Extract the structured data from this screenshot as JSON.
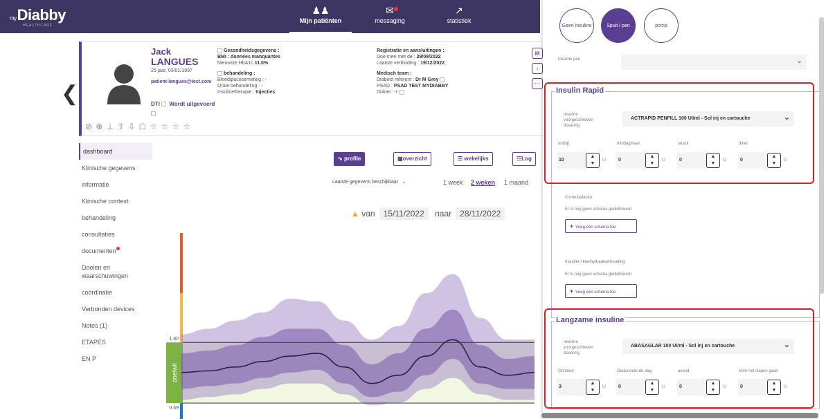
{
  "brand": {
    "prefix": "my",
    "name": "Diabby",
    "sub": "HEALTHCARE"
  },
  "nav": [
    {
      "label": "Mijn patiënten",
      "icon": "users-icon",
      "active": true
    },
    {
      "label": "messaging",
      "icon": "chat-icon",
      "active": false,
      "badge": true
    },
    {
      "label": "statistiek",
      "icon": "chart-icon",
      "active": false
    }
  ],
  "patient": {
    "first": "Jack",
    "last": "LANGUES",
    "age": "25 jaar, 03/01/1997",
    "email": "patient-langues@test.com",
    "dti": "DTI",
    "dti_status": "Wordt uitgevoerd",
    "icons": "⊘ ⊕ ⊥ ⇧ ⇩ ☖ ☆ ☆ ☆ ☆"
  },
  "health": {
    "title": "Gezondheidsgegevens :",
    "bmi": "BMI : données manquantes",
    "hba1c_label": "Nieuwste HbA1c",
    "hba1c": "11.0%",
    "treat_title": "behandeling :",
    "glucose": "Bloedglucosemeting : -",
    "oral": "Orale behandeling : -",
    "insulin_label": "Insulinetherapie :",
    "insulin": "Injecties"
  },
  "registration": {
    "title": "Registratie en aansluitingen :",
    "since_label": "Doe mee met de :",
    "since": "29/09/2022",
    "last_label": "Laatste verbinding :",
    "last": "19/12/2022",
    "team_title": "Medisch team :",
    "ref_label": "Diabeto referent :",
    "ref": "Dr M Grey",
    "psad_label": "PSAD :",
    "psad": "PSAD TEST MYDIABBY",
    "doctor": "Dokter : +"
  },
  "sidebar": [
    {
      "label": "dashboard",
      "active": true
    },
    {
      "label": "Klinische gegevens"
    },
    {
      "label": "informatie"
    },
    {
      "label": "Klinische context"
    },
    {
      "label": "behandeling"
    },
    {
      "label": "consultaties"
    },
    {
      "label": "documenten",
      "badge": true
    },
    {
      "label": "Doelen en waarschuwingen"
    },
    {
      "label": "coördinatie"
    },
    {
      "label": "Verbonden devices"
    },
    {
      "label": "Notes (1)"
    },
    {
      "label": "ETAPES"
    },
    {
      "label": "EN P"
    }
  ],
  "toolbar": {
    "profile": "profile",
    "overview": "overzicht",
    "weekly": "wekelijks",
    "log": "Log"
  },
  "period": {
    "select": "Laatste gegevens beschikbaar",
    "w1": "1 week",
    "w2": "2 weken",
    "m1": "1 maand"
  },
  "dates": {
    "from_label": "van",
    "from": "15/11/2022",
    "to_label": "naar",
    "to": "28/11/2022"
  },
  "chart_data": {
    "type": "area",
    "target_label": "doelwit",
    "y_ticks": [
      "1.80",
      "0.69"
    ],
    "target_range": [
      0.69,
      1.8
    ],
    "ylim": [
      0.4,
      3.8
    ],
    "x": [
      0,
      1,
      2,
      3,
      4,
      5,
      6,
      7,
      8,
      9,
      10,
      11,
      12,
      13
    ],
    "series": [
      {
        "role": "median",
        "values": [
          1.25,
          1.28,
          1.35,
          1.45,
          1.55,
          1.6,
          1.35,
          1.05,
          1.2,
          1.55,
          1.85,
          1.35,
          1.2,
          1.25
        ]
      },
      {
        "role": "p25-p75",
        "low": [
          0.95,
          1.0,
          1.05,
          1.15,
          1.25,
          1.3,
          1.05,
          0.8,
          0.9,
          1.2,
          1.5,
          1.05,
          0.95,
          0.95
        ],
        "high": [
          1.6,
          1.65,
          1.75,
          1.9,
          2.05,
          2.05,
          1.75,
          1.4,
          1.6,
          2.05,
          2.4,
          1.75,
          1.5,
          1.55
        ]
      },
      {
        "role": "p10-p90",
        "low": [
          0.75,
          0.8,
          0.85,
          0.95,
          1.05,
          1.05,
          0.85,
          0.65,
          0.7,
          0.95,
          1.15,
          0.85,
          0.75,
          0.75
        ],
        "high": [
          1.95,
          2.05,
          2.2,
          2.35,
          2.6,
          2.55,
          2.2,
          1.85,
          2.1,
          2.7,
          3.05,
          2.25,
          1.85,
          1.85
        ]
      }
    ]
  },
  "panel": {
    "pills": [
      "Geen insuline",
      "Spuit / pen",
      "pomp"
    ],
    "pen_label": "insuline pen",
    "rapid": {
      "title": "Insulin Rapid",
      "prescribed": "Insuline voorgeschreven dosering",
      "insulin": "ACTRAPID PENFILL 100 UI/ml - Sol inj en cartouche",
      "cols": [
        "ontbijt",
        "middagmaal",
        "snack",
        "diner"
      ],
      "values": [
        "10",
        "0",
        "0",
        "0"
      ],
      "unit": "U",
      "correction": "Correctiefactor",
      "none1": "Er is nog geen schema gedefinieerd",
      "add": "Voeg een schema toe",
      "ratio": "Insuline / koolhydraatverhouding",
      "none2": "Er is nog geen schema gedefinieerd"
    },
    "slow": {
      "title": "Langzame insuline",
      "prescribed": "Insuline voorgeschreven dosering",
      "insulin": "ABASAGLAR 100 UI/ml - Sol inj en cartouche",
      "cols": [
        "Ochtend",
        "Gedurende de dag",
        "avond",
        "Voor het slapen gaan"
      ],
      "values": [
        "3",
        "0",
        "0",
        "0"
      ],
      "unit": "U"
    }
  },
  "colors": {
    "primary": "#5a3e91",
    "header": "#3d3660",
    "target": "#7cb342",
    "alert": "#e02020"
  }
}
